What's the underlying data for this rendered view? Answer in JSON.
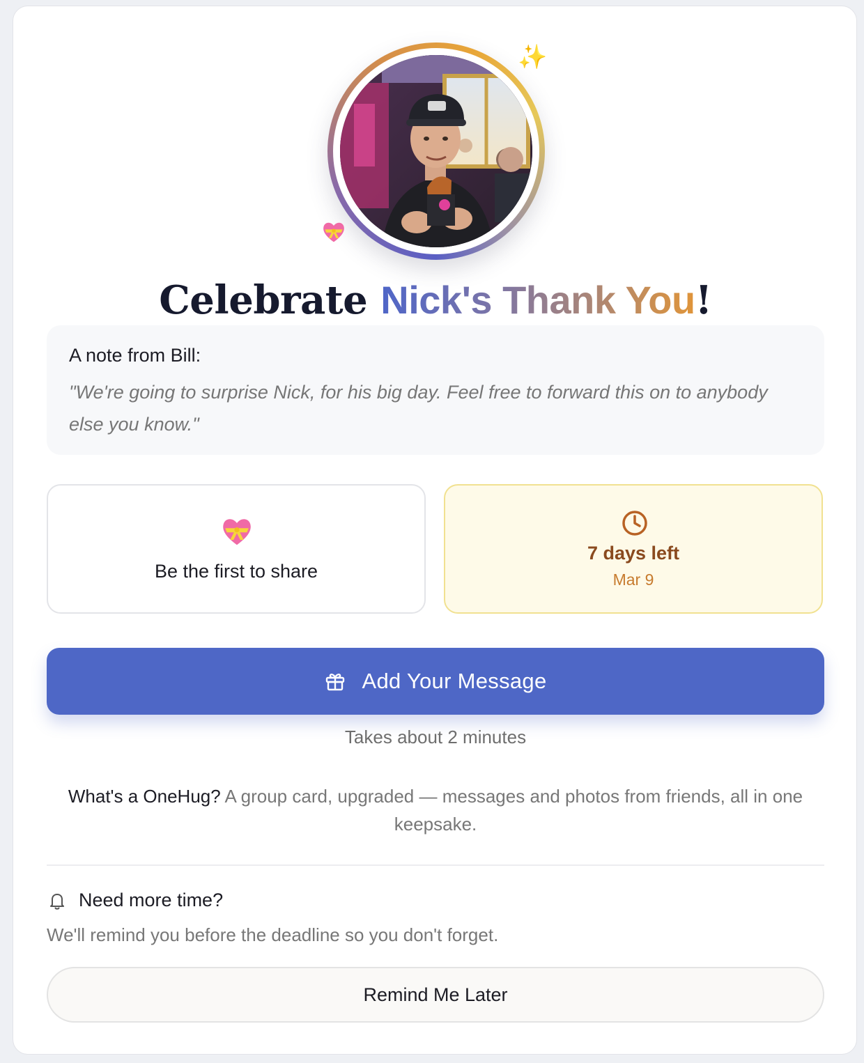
{
  "header": {
    "title_prefix": "Celebrate",
    "title_highlight": "Nick's Thank You",
    "title_suffix": "!",
    "avatar_alt": "Nick",
    "sparkle_glyph": "✨"
  },
  "note": {
    "label": "A note from Bill:",
    "text": "\"We're going to surprise Nick, for his big day. Feel free to forward this on to anybody else you know.\""
  },
  "stats": {
    "share_label": "Be the first to share",
    "days_left": "7 days left",
    "deadline_date": "Mar 9"
  },
  "actions": {
    "add_message_label": "Add Your Message",
    "takes_time": "Takes about 2 minutes"
  },
  "about": {
    "question": "What's a OneHug?",
    "answer": "A group card, upgraded — messages and photos from friends, all in one keepsake."
  },
  "reminder": {
    "title": "Need more time?",
    "subtitle": "We'll remind you before the deadline so you don't forget.",
    "button_label": "Remind Me Later"
  },
  "colors": {
    "accent": "#4e67c6",
    "deadline_bg": "#fefae8",
    "deadline_border": "#f1e190",
    "deadline_text": "#8a4a1e",
    "deadline_date": "#c77b2e"
  },
  "icons": {
    "sparkle": "sparkles-icon",
    "heart": "heart-with-ribbon-icon",
    "clock": "clock-icon",
    "gift": "gift-icon",
    "bell": "bell-icon"
  }
}
